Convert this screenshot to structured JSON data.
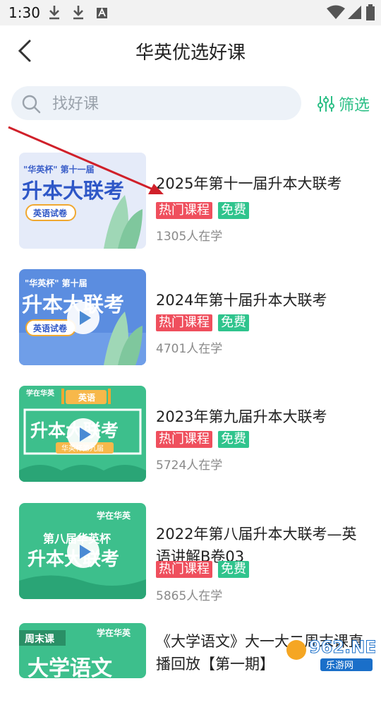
{
  "status_bar": {
    "time": "1:30",
    "icons": [
      "download-icon",
      "download-icon",
      "a-letter-icon",
      "wifi-icon",
      "signal-icon",
      "battery-icon"
    ]
  },
  "header": {
    "title": "华英优选好课",
    "back_icon": "chevron-left-icon"
  },
  "search": {
    "placeholder": "找好课",
    "value": "",
    "filter_label": "筛选"
  },
  "colors": {
    "accent": "#2cbf86",
    "hot_tag": "#ef4f5d",
    "free_tag": "#2fc48d",
    "search_bg": "#edf2f8",
    "annotation_arrow": "#d0202a"
  },
  "courses": [
    {
      "title": "2025年第十一届升本大联考",
      "tags": [
        "热门课程",
        "免费"
      ],
      "learners": "1305人在学",
      "thumb": {
        "title_small": "\"华英杯\" 第十一届",
        "title_big": "升本大联考",
        "badge": "英语试卷"
      }
    },
    {
      "title": "2024年第十届升本大联考",
      "tags": [
        "热门课程",
        "免费"
      ],
      "learners": "4701人在学",
      "thumb": {
        "title_small": "\"华英杯\" 第十届",
        "title_big": "升本大联考",
        "badge": "英语试卷"
      }
    },
    {
      "title": "2023年第九届升本大联考",
      "tags": [
        "热门课程",
        "免费"
      ],
      "learners": "5724人在学",
      "thumb": {
        "brand": "学在华英",
        "sign": "英语",
        "title_big": "升本大联考",
        "ribbon": "华英杯第九届"
      }
    },
    {
      "title": "2022年第八届升本大联考—英语讲解B卷03",
      "tags": [
        "热门课程",
        "免费"
      ],
      "learners": "5865人在学",
      "thumb": {
        "brand": "学在华英",
        "title_small": "第八届华英杯",
        "title_big": "升本大联考"
      }
    },
    {
      "title": "《大学语文》大一大二周末课直播回放【第一期】",
      "tags": [],
      "learners": "",
      "thumb": {
        "label": "周末课",
        "brand": "学在华英",
        "title_big": "大学语文"
      }
    }
  ],
  "watermark": {
    "text": "962.NET",
    "subtext": "乐游网"
  }
}
